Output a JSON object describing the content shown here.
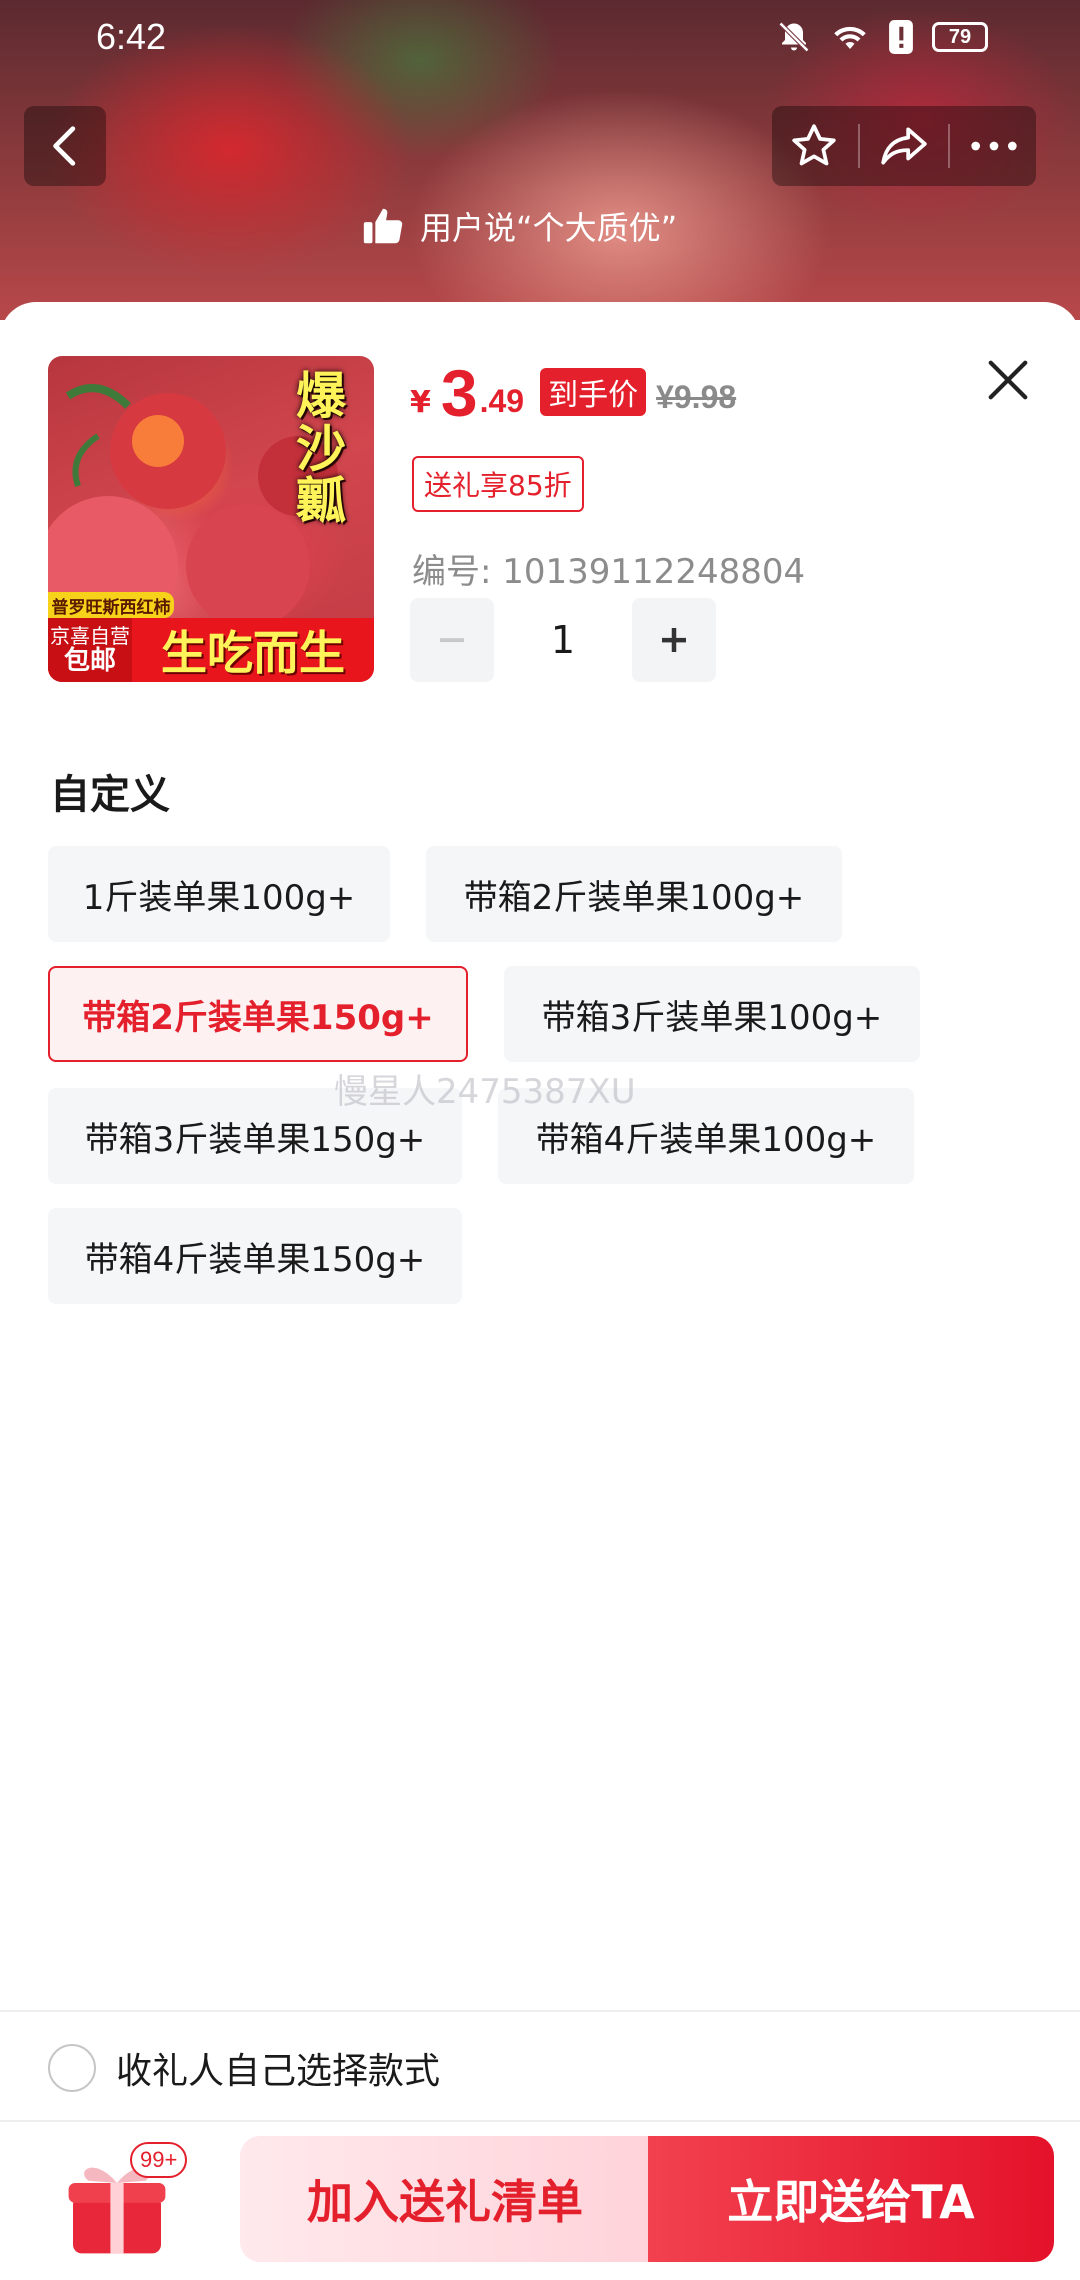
{
  "status_bar": {
    "time": "6:42",
    "battery": "79",
    "icons": [
      "bell-off-icon",
      "wifi-icon",
      "alert-icon",
      "battery-icon"
    ]
  },
  "header": {
    "banner_text": "用户说“个大质优”",
    "icons": [
      "back-icon",
      "star-icon",
      "share-icon",
      "more-icon"
    ]
  },
  "product": {
    "image": {
      "vertical_text": "爆沙瓤",
      "tag": "普罗旺斯西红柿",
      "badge_line1": "京喜自营",
      "badge_line2": "包邮",
      "slogan": "生吃而生"
    },
    "price": {
      "currency": "¥",
      "integer": "3",
      "decimal": ".49",
      "tag": "到手价",
      "original": "¥9.98"
    },
    "coupon": "送礼享85折",
    "sku": "编号: 10139112248804",
    "quantity": "1"
  },
  "options": {
    "title": "自定义",
    "items": [
      {
        "label": "1斤装单果100g+",
        "selected": false
      },
      {
        "label": "带箱2斤装单果100g+",
        "selected": false
      },
      {
        "label": "带箱2斤装单果150g+",
        "selected": true
      },
      {
        "label": "带箱3斤装单果100g+",
        "selected": false
      },
      {
        "label": "带箱3斤装单果150g+",
        "selected": false
      },
      {
        "label": "带箱4斤装单果100g+",
        "selected": false
      },
      {
        "label": "带箱4斤装单果150g+",
        "selected": false
      }
    ]
  },
  "watermark": "慢星人2475387XU",
  "recipient": {
    "label": "收礼人自己选择款式"
  },
  "footer": {
    "gift_badge": "99+",
    "add_label": "加入送礼清单",
    "send_label": "立即送给TA"
  },
  "colors": {
    "accent": "#e4202c",
    "option_bg": "#f5f6f8",
    "selected_bg": "#fdf1f2"
  }
}
